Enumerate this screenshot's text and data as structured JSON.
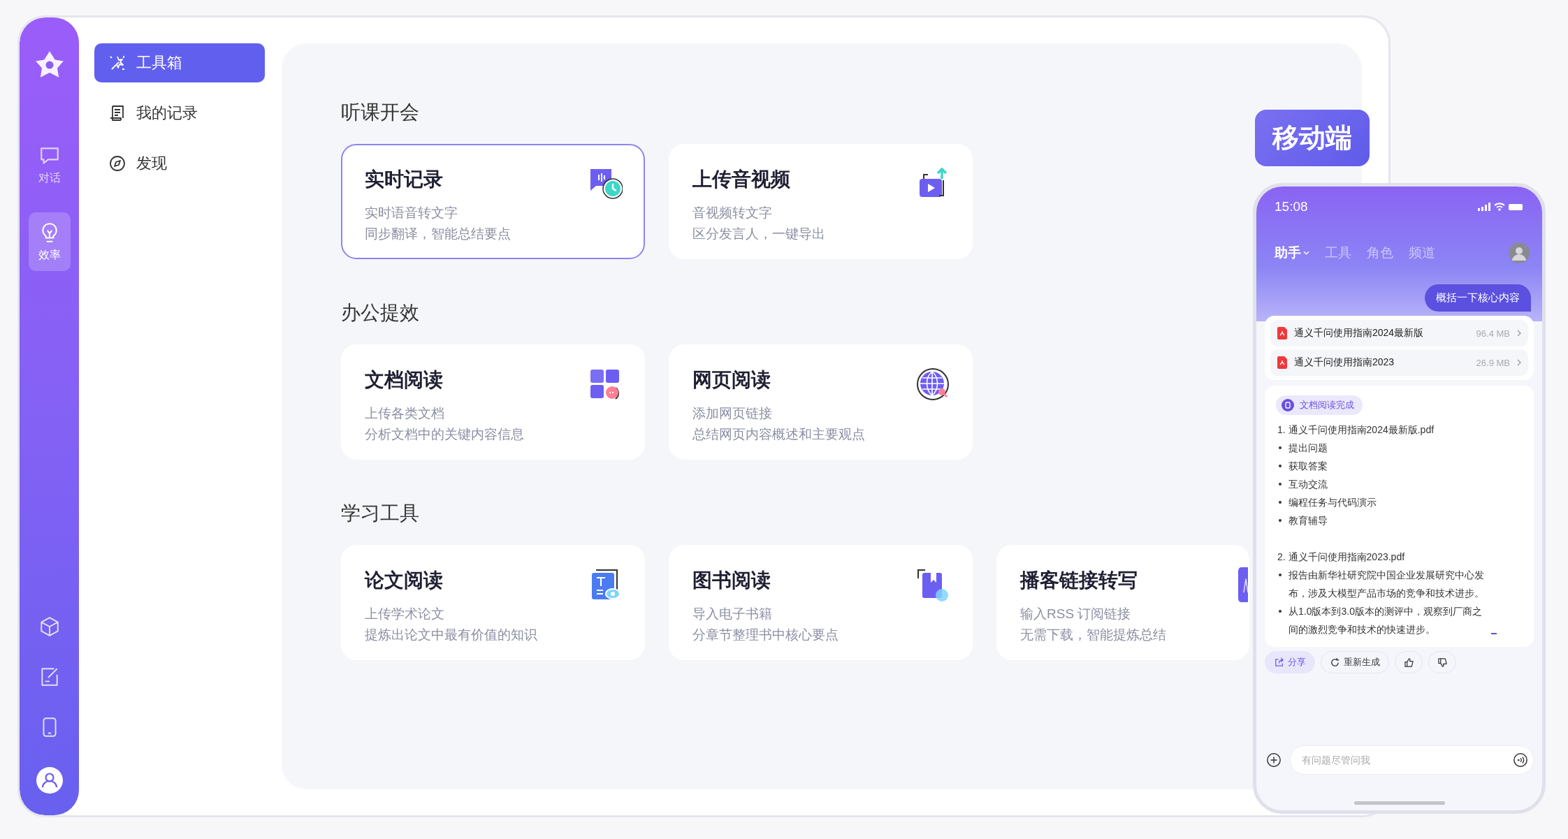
{
  "rail": {
    "items": [
      {
        "label": "对话",
        "selected": false
      },
      {
        "label": "效率",
        "selected": true
      }
    ]
  },
  "nav": [
    {
      "label": "工具箱",
      "selected": true
    },
    {
      "label": "我的记录",
      "selected": false
    },
    {
      "label": "发现",
      "selected": false
    }
  ],
  "sections": [
    {
      "title": "听课开会",
      "cards": [
        {
          "title": "实时记录",
          "lines": [
            "实时语音转文字",
            "同步翻译，智能总结要点"
          ],
          "selected": true
        },
        {
          "title": "上传音视频",
          "lines": [
            "音视频转文字",
            "区分发言人，一键导出"
          ],
          "selected": false
        }
      ]
    },
    {
      "title": "办公提效",
      "cards": [
        {
          "title": "文档阅读",
          "lines": [
            "上传各类文档",
            "分析文档中的关键内容信息"
          ],
          "selected": false
        },
        {
          "title": "网页阅读",
          "lines": [
            "添加网页链接",
            "总结网页内容概述和主要观点"
          ],
          "selected": false
        }
      ]
    },
    {
      "title": "学习工具",
      "cards": [
        {
          "title": "论文阅读",
          "lines": [
            "上传学术论文",
            "提炼出论文中最有价值的知识"
          ],
          "selected": false
        },
        {
          "title": "图书阅读",
          "lines": [
            "导入电子书籍",
            "分章节整理书中核心要点"
          ],
          "selected": false
        },
        {
          "title": "播客链接转写",
          "lines": [
            "输入RSS 订阅链接",
            "无需下载，智能提炼总结"
          ],
          "selected": false
        }
      ]
    }
  ],
  "mobile_badge": "移动端",
  "phone": {
    "time": "15:08",
    "tabs": [
      {
        "label": "助手",
        "selected": true
      },
      {
        "label": "工具",
        "selected": false
      },
      {
        "label": "角色",
        "selected": false
      },
      {
        "label": "频道",
        "selected": false
      }
    ],
    "user_message": "概括一下核心内容",
    "files": [
      {
        "name": "通义千问使用指南2024最新版",
        "size": "96.4 MB"
      },
      {
        "name": "通义千问使用指南2023",
        "size": "26.9 MB"
      }
    ],
    "status": "文档阅读完成",
    "answer": [
      {
        "kind": "heading",
        "text": "1. 通义千问使用指南2024最新版.pdf"
      },
      {
        "kind": "bullet",
        "text": "提出问题"
      },
      {
        "kind": "bullet",
        "text": "获取答案"
      },
      {
        "kind": "bullet",
        "text": "互动交流"
      },
      {
        "kind": "bullet",
        "text": "编程任务与代码演示"
      },
      {
        "kind": "bullet",
        "text": "教育辅导"
      },
      {
        "kind": "heading",
        "text": "2. 通义千问使用指南2023.pdf"
      },
      {
        "kind": "bullet",
        "text": "报告由新华社研究院中国企业发展研究中心发布，涉及大模型产品市场的竞争和技术进步。"
      },
      {
        "kind": "bullet",
        "text": "从1.0版本到3.0版本的测评中，观察到厂商之间的激烈竞争和技术的快速进步。"
      }
    ],
    "actions": [
      {
        "kind": "share",
        "label": "分享",
        "selected": true
      },
      {
        "kind": "regenerate",
        "label": "重新生成",
        "selected": false
      },
      {
        "kind": "like",
        "selected": false
      },
      {
        "kind": "dislike",
        "selected": false
      }
    ],
    "input": {
      "placeholder": "有问题尽管问我"
    }
  }
}
